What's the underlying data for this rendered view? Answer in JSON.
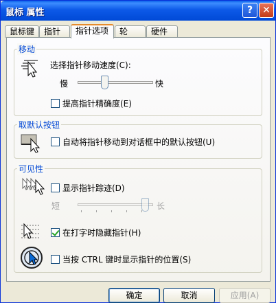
{
  "window": {
    "title": "鼠标 属性",
    "help_glyph": "?",
    "close_glyph": "✕"
  },
  "tabs": [
    {
      "label": "鼠标键",
      "active": false
    },
    {
      "label": "指针",
      "active": false
    },
    {
      "label": "指针选项",
      "active": true
    },
    {
      "label": "轮",
      "active": false
    },
    {
      "label": "硬件",
      "active": false
    }
  ],
  "motion": {
    "legend": "移动",
    "speed_label": "选择指针移动速度(C):",
    "slow": "慢",
    "fast": "快",
    "speed_level": 0.45,
    "precision_label": "提高指针精确度(E)",
    "precision_checked": false
  },
  "snap": {
    "legend": "取默认按钮",
    "label": "自动将指针移动到对话框中的默认按钮(U)",
    "checked": false
  },
  "visibility": {
    "legend": "可见性",
    "trails_label": "显示指针踪迹(D)",
    "trails_checked": false,
    "short": "短",
    "long": "长",
    "trails_level": 1.0,
    "hide_label": "在打字时隐藏指针(H)",
    "hide_checked": true,
    "ctrl_label": "当按 CTRL 键时显示指针的位置(S)",
    "ctrl_checked": false
  },
  "buttons": {
    "ok": "确定",
    "cancel": "取消",
    "apply": "应用(A)"
  },
  "colors": {
    "accent": "#0046d5",
    "titlebar": "#0054e3",
    "active_tab": "#e68b2c"
  }
}
